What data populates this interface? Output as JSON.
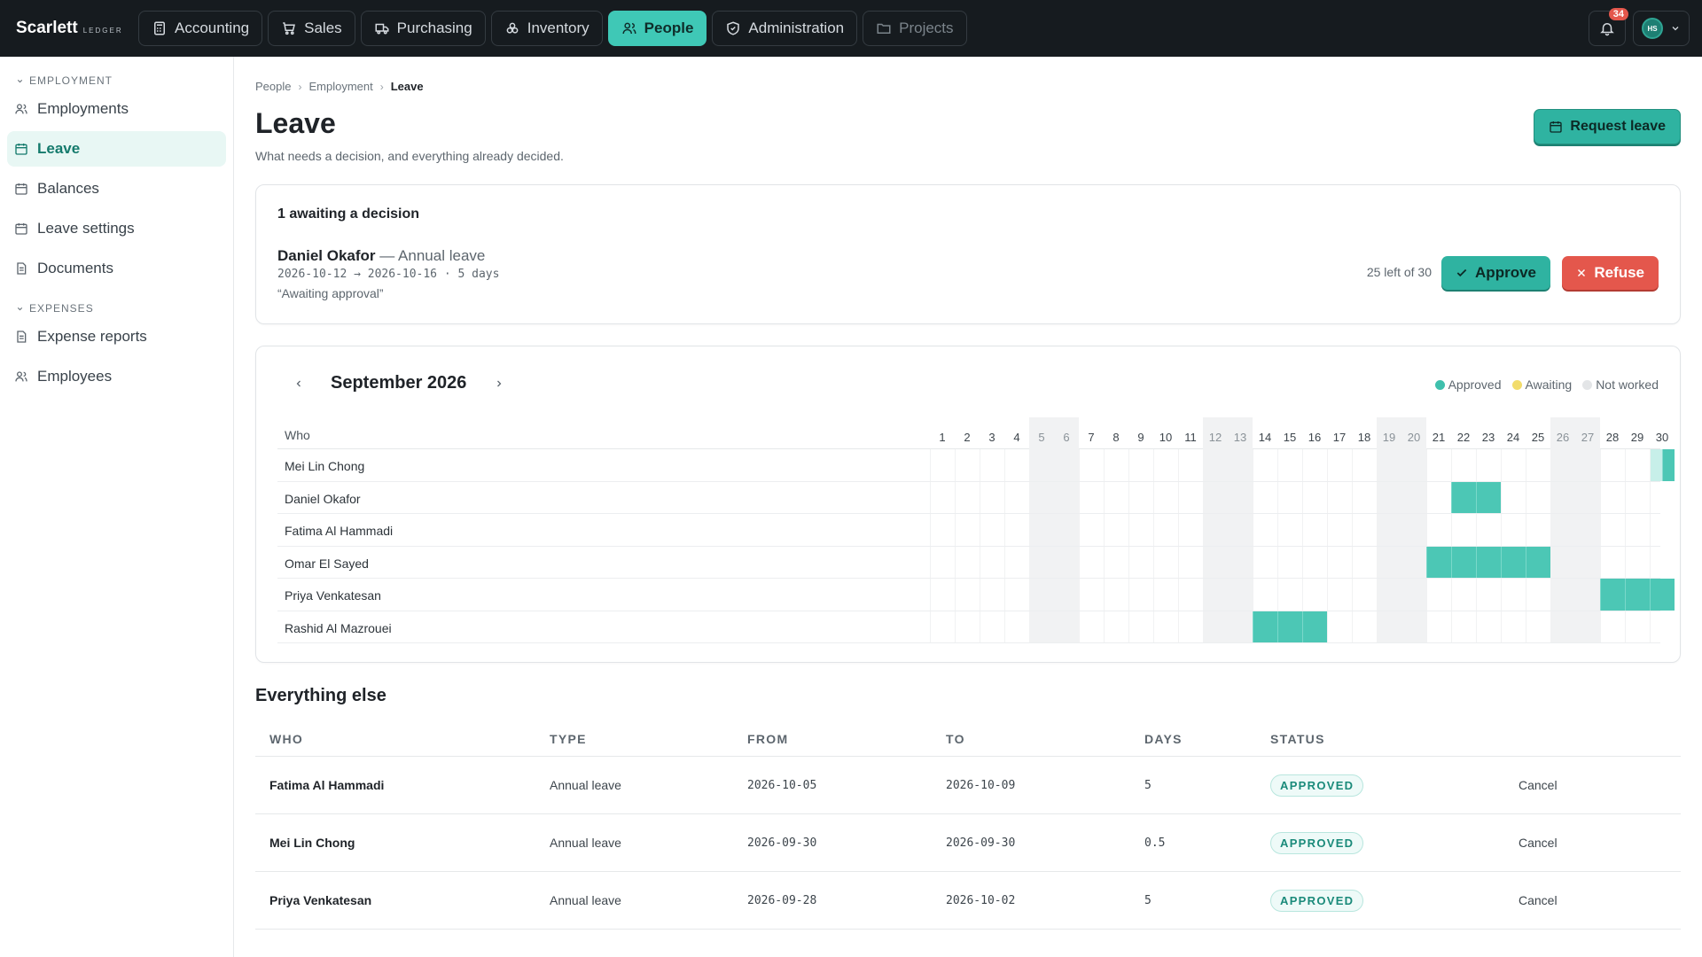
{
  "app": {
    "brand": "Scarlett",
    "brand_sub": "LEDGER"
  },
  "topnav": [
    {
      "label": "Accounting",
      "icon": "calculator-icon",
      "state": "normal"
    },
    {
      "label": "Sales",
      "icon": "cart-icon",
      "state": "normal"
    },
    {
      "label": "Purchasing",
      "icon": "truck-icon",
      "state": "normal"
    },
    {
      "label": "Inventory",
      "icon": "boxes-icon",
      "state": "normal"
    },
    {
      "label": "People",
      "icon": "people-icon",
      "state": "active"
    },
    {
      "label": "Administration",
      "icon": "shield-icon",
      "state": "normal"
    },
    {
      "label": "Projects",
      "icon": "folder-icon",
      "state": "disabled"
    }
  ],
  "header": {
    "notifications": "34",
    "user_initials": "HS"
  },
  "sidebar": {
    "sections": [
      {
        "title": "EMPLOYMENT",
        "items": [
          {
            "label": "Employments",
            "icon": "people-icon",
            "active": false
          },
          {
            "label": "Leave",
            "icon": "calendar-icon",
            "active": true
          },
          {
            "label": "Balances",
            "icon": "calendar-icon",
            "active": false
          },
          {
            "label": "Leave settings",
            "icon": "calendar-icon",
            "active": false
          },
          {
            "label": "Documents",
            "icon": "document-icon",
            "active": false
          }
        ]
      },
      {
        "title": "EXPENSES",
        "items": [
          {
            "label": "Expense reports",
            "icon": "document-icon",
            "active": false
          },
          {
            "label": "Employees",
            "icon": "people-icon",
            "active": false
          }
        ]
      }
    ]
  },
  "breadcrumb": [
    "People",
    "Employment",
    "Leave"
  ],
  "page": {
    "title": "Leave",
    "subtitle": "What needs a decision, and everything already decided.",
    "request_button": "Request leave"
  },
  "pending": {
    "title": "1 awaiting a decision",
    "name": "Daniel Okafor",
    "type": " — Annual leave",
    "dates": "2026-10-12 → 2026-10-16 · 5 days",
    "note": "“Awaiting approval”",
    "balance": "25 left of 30",
    "approve": "Approve",
    "refuse": "Refuse"
  },
  "calendar": {
    "month": "September 2026",
    "who_label": "Who",
    "legend": [
      {
        "label": "Approved",
        "color": "#3fc0ad"
      },
      {
        "label": "Awaiting",
        "color": "#f2dc6b"
      },
      {
        "label": "Not worked",
        "color": "#e3e5e7"
      }
    ],
    "days": [
      "1",
      "2",
      "3",
      "4",
      "5",
      "6",
      "7",
      "8",
      "9",
      "10",
      "11",
      "12",
      "13",
      "14",
      "15",
      "16",
      "17",
      "18",
      "19",
      "20",
      "21",
      "22",
      "23",
      "24",
      "25",
      "26",
      "27",
      "28",
      "29",
      "30"
    ],
    "weekends": [
      5,
      6,
      12,
      13,
      19,
      20,
      26,
      27
    ],
    "rows": [
      {
        "name": "Mei Lin Chong",
        "leave": [
          30
        ],
        "half": [
          30
        ]
      },
      {
        "name": "Daniel Okafor",
        "leave": [
          22,
          23
        ],
        "half": []
      },
      {
        "name": "Fatima Al Hammadi",
        "leave": [],
        "half": []
      },
      {
        "name": "Omar El Sayed",
        "leave": [
          21,
          22,
          23,
          24,
          25
        ],
        "half": []
      },
      {
        "name": "Priya Venkatesan",
        "leave": [
          28,
          29,
          30
        ],
        "half": []
      },
      {
        "name": "Rashid Al Mazrouei",
        "leave": [
          14,
          15,
          16
        ],
        "half": []
      }
    ]
  },
  "everything_else": {
    "title": "Everything else",
    "columns": [
      "WHO",
      "TYPE",
      "FROM",
      "TO",
      "DAYS",
      "STATUS"
    ],
    "rows": [
      {
        "who": "Fatima Al Hammadi",
        "type": "Annual leave",
        "from": "2026-10-05",
        "to": "2026-10-09",
        "days": "5",
        "status": "APPROVED",
        "action": "Cancel"
      },
      {
        "who": "Mei Lin Chong",
        "type": "Annual leave",
        "from": "2026-09-30",
        "to": "2026-09-30",
        "days": "0.5",
        "status": "APPROVED",
        "action": "Cancel"
      },
      {
        "who": "Priya Venkatesan",
        "type": "Annual leave",
        "from": "2026-09-28",
        "to": "2026-10-02",
        "days": "5",
        "status": "APPROVED",
        "action": "Cancel"
      }
    ]
  }
}
